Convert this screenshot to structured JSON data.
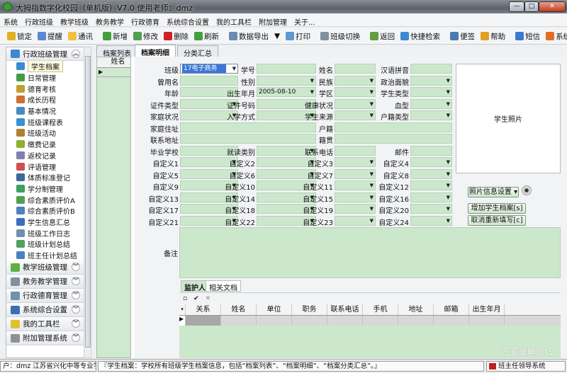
{
  "window": {
    "title": "大拇指数字化校园（单机版）V7.0 使用老师：dmz",
    "controls": [
      "—",
      "□",
      "✕"
    ]
  },
  "menu": [
    "系统",
    "行政班级",
    "教学班级",
    "教务教学",
    "行政德育",
    "系统综合设置",
    "我的工具栏",
    "附加管理",
    "关于..."
  ],
  "toolbar": [
    {
      "label": "锁定",
      "icon": "lock-icon",
      "color": "#e0b020"
    },
    {
      "label": "提醒",
      "icon": "reminder-icon",
      "color": "#5a8ad0"
    },
    {
      "label": "通讯",
      "icon": "chat-icon",
      "color": "#f0c040"
    },
    {
      "sep": true
    },
    {
      "label": "新增",
      "icon": "plus-icon",
      "color": "#40a040"
    },
    {
      "label": "修改",
      "icon": "check-icon",
      "color": "#50a050"
    },
    {
      "label": "删除",
      "icon": "delete-icon",
      "color": "#d02020"
    },
    {
      "label": "刷新",
      "icon": "refresh-icon",
      "color": "#40a040"
    },
    {
      "sep": true
    },
    {
      "label": "数据导出",
      "icon": "export-icon",
      "color": "#6a8ab0"
    },
    {
      "label": "▼",
      "icon": "dropdown-arrow-icon",
      "color": ""
    },
    {
      "label": "打印",
      "icon": "print-icon",
      "color": "#5a9ad0"
    },
    {
      "sep": true
    },
    {
      "label": "班级切换",
      "icon": "switch-class-icon",
      "color": "#8090a0"
    },
    {
      "sep": true
    },
    {
      "label": "返回",
      "icon": "back-icon",
      "color": "#60a040"
    },
    {
      "label": "快捷检索",
      "icon": "search-icon",
      "color": "#3a8ad0"
    },
    {
      "sep": true
    },
    {
      "label": "便签",
      "icon": "pin-icon",
      "color": "#4a7ab0"
    },
    {
      "label": "帮助",
      "icon": "help-icon",
      "color": "#e0a020"
    },
    {
      "sep": true
    },
    {
      "label": "短信",
      "icon": "globe-icon",
      "color": "#3a7ad0"
    },
    {
      "label": "系统退出",
      "icon": "power-icon",
      "color": "#e07020"
    }
  ],
  "sidebar": {
    "top_group": "行政班级管理",
    "items": [
      "学生档案",
      "日常管理",
      "德育考核",
      "成长历程",
      "基本情况",
      "班级课程表",
      "班级活动",
      "缴费记录",
      "返校记录",
      "评语管理",
      "体质标准登记",
      "学分制管理",
      "综合素质评价A",
      "综合素质评价B",
      "学生信息汇总",
      "班级工作日志",
      "班级计划总结",
      "班主任计划总结"
    ],
    "selected": "学生档案",
    "groups": [
      "教学班级管理",
      "教务教学管理",
      "行政德育管理",
      "系统综合设置",
      "我的工具栏",
      "附加管理系统"
    ]
  },
  "tabs": [
    "档案列表",
    "档案明细",
    "分类汇总"
  ],
  "active_tab": "档案明细",
  "list": {
    "header": "姓名"
  },
  "form": {
    "rows": [
      [
        {
          "l": "班级",
          "t": "sel",
          "v": "17电子商务"
        },
        {
          "l": "学号",
          "t": "text"
        },
        {
          "l": "姓名",
          "t": "text"
        },
        {
          "l": "汉语拼音",
          "t": "text"
        }
      ],
      [
        {
          "l": "曾用名",
          "t": "text"
        },
        {
          "l": "性别",
          "t": "dd"
        },
        {
          "l": "民族",
          "t": "dd"
        },
        {
          "l": "政治面貌",
          "t": "dd"
        }
      ],
      [
        {
          "l": "年龄",
          "t": "text"
        },
        {
          "l": "出生年月",
          "t": "dd",
          "v": "2005-08-10"
        },
        {
          "l": "学区",
          "t": "dd"
        },
        {
          "l": "学生类型",
          "t": "dd"
        }
      ],
      [
        {
          "l": "证件类型",
          "t": "dd"
        },
        {
          "l": "证件号码",
          "t": "text"
        },
        {
          "l": "健康状况",
          "t": "dd"
        },
        {
          "l": "血型",
          "t": "dd"
        }
      ],
      [
        {
          "l": "家庭状况",
          "t": "dd"
        },
        {
          "l": "入学方式",
          "t": "dd"
        },
        {
          "l": "学生来源",
          "t": "dd"
        },
        {
          "l": "户籍类型",
          "t": "dd"
        }
      ],
      [
        {
          "l": "家庭住址",
          "t": "wide"
        },
        {
          "l": "户籍",
          "t": "wide"
        }
      ],
      [
        {
          "l": "联系地址",
          "t": "wide"
        },
        {
          "l": "籍贯",
          "t": "wide"
        }
      ],
      [
        {
          "l": "毕业学校",
          "t": "text"
        },
        {
          "l": "就读类别",
          "t": "dd"
        },
        {
          "l": "联系电话",
          "t": "text"
        },
        {
          "l": "邮件",
          "t": "text"
        }
      ],
      [
        {
          "l": "自定义1",
          "t": "dd"
        },
        {
          "l": "自定义2",
          "t": "dd"
        },
        {
          "l": "自定义3",
          "t": "dd"
        },
        {
          "l": "自定义4",
          "t": "dd"
        }
      ],
      [
        {
          "l": "自定义5",
          "t": "dd"
        },
        {
          "l": "自定义6",
          "t": "dd"
        },
        {
          "l": "自定义7",
          "t": "dd"
        },
        {
          "l": "自定义8",
          "t": "dd"
        }
      ],
      [
        {
          "l": "自定义9",
          "t": "dd"
        },
        {
          "l": "自定义10",
          "t": "dd"
        },
        {
          "l": "自定义11",
          "t": "dd"
        },
        {
          "l": "自定义12",
          "t": "dd"
        }
      ],
      [
        {
          "l": "自定义13",
          "t": "dd"
        },
        {
          "l": "自定义14",
          "t": "dd"
        },
        {
          "l": "自定义15",
          "t": "dd"
        },
        {
          "l": "自定义16",
          "t": "dd"
        }
      ],
      [
        {
          "l": "自定义17",
          "t": "dd"
        },
        {
          "l": "自定义18",
          "t": "dd"
        },
        {
          "l": "自定义19",
          "t": "dd"
        },
        {
          "l": "自定义20",
          "t": "dd"
        }
      ],
      [
        {
          "l": "自定义21",
          "t": "dd"
        },
        {
          "l": "自定义22",
          "t": "dd"
        },
        {
          "l": "自定义23",
          "t": "dd"
        },
        {
          "l": "自定义24",
          "t": "dd"
        }
      ]
    ],
    "remark_label": "备注",
    "photo_label": "学生照片",
    "photo_settings": "照片信息设置 ▾",
    "add_button": "增加学生档案[s]",
    "reset_button": "取消重新填写[c]"
  },
  "subtabs": [
    "监护人",
    "相关文档"
  ],
  "grid": {
    "toolbar": [
      "▫",
      "✔",
      "✕"
    ],
    "columns": [
      "关系",
      "姓名",
      "单位",
      "职务",
      "联系电话",
      "手机",
      "地址",
      "邮箱",
      "出生年月"
    ]
  },
  "status": {
    "user": "户：dmz 江苏省兴化中等专业学",
    "message": "『学生档案：学校所有班级学生档案信息，包括“档案列表”、“档案明细”、“档案分类汇总”。』",
    "module": "班主任领导系统"
  },
  "watermark": "吾爱破解论坛"
}
